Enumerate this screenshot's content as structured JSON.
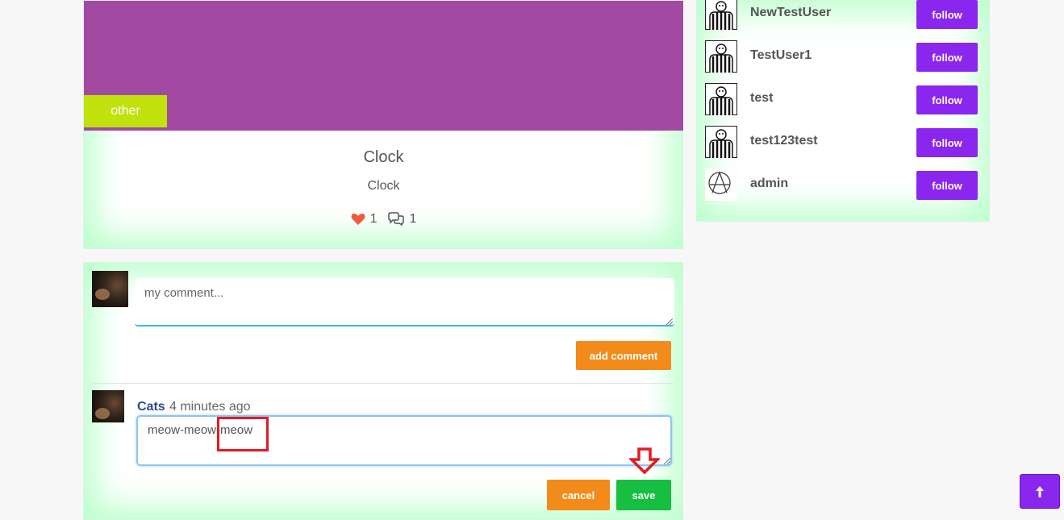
{
  "post": {
    "category": "other",
    "title": "Clock",
    "description": "Clock",
    "likes": "1",
    "comments": "1",
    "image_color": "#a24aa2"
  },
  "new_comment": {
    "placeholder": "my comment...",
    "add_label": "add comment"
  },
  "comment": {
    "author": "Cats",
    "time": "4 minutes ago",
    "text": "meow-meow-meow",
    "cancel_label": "cancel",
    "save_label": "save"
  },
  "users": [
    {
      "name": "NewTestUser",
      "avatar": "referee-avatar",
      "follow_label": "follow"
    },
    {
      "name": "TestUser1",
      "avatar": "referee-avatar",
      "follow_label": "follow"
    },
    {
      "name": "test",
      "avatar": "referee-avatar",
      "follow_label": "follow"
    },
    {
      "name": "test123test",
      "avatar": "referee-avatar",
      "follow_label": "follow"
    },
    {
      "name": "admin",
      "avatar": "anarchy-avatar",
      "follow_label": "follow"
    }
  ],
  "colors": {
    "accent": "#8a26ee",
    "orange": "#f28b1a",
    "green": "#16bf3f",
    "category": "#c1e20d"
  }
}
